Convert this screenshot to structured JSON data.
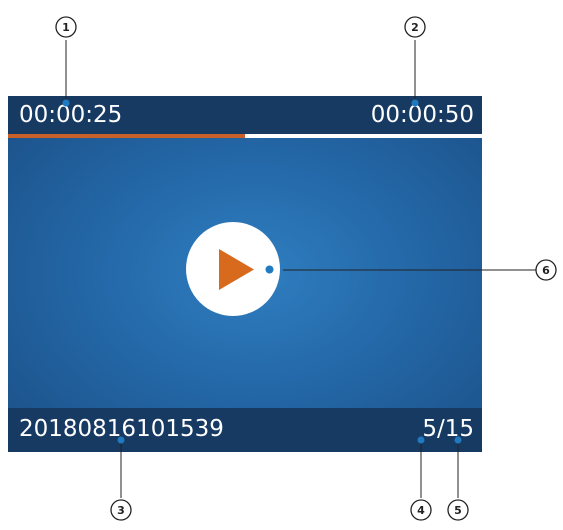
{
  "player": {
    "elapsed_time": "00:00:25",
    "total_time": "00:00:50",
    "progress": 0.5,
    "filename": "20180816101539",
    "file_counter": "5/15",
    "play_icon": "play-icon"
  },
  "callouts": [
    "1",
    "2",
    "3",
    "4",
    "5",
    "6"
  ],
  "colors": {
    "bar_background": "#173a63",
    "screen_background": "#2468a8",
    "progress_fill": "#c8602a",
    "play_icon": "#d86a1e"
  }
}
